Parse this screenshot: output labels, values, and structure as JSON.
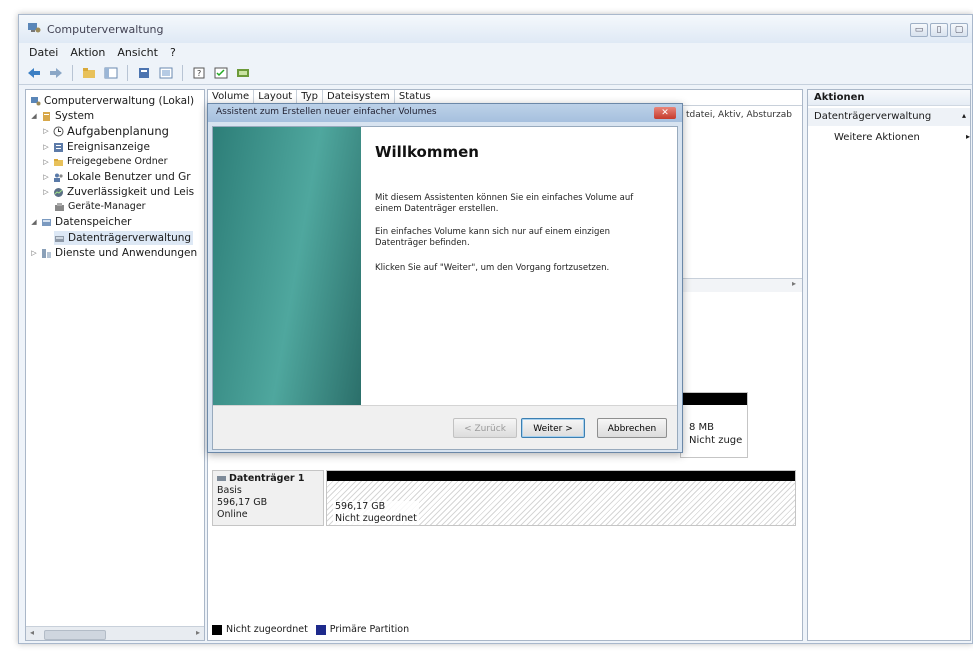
{
  "window": {
    "title": "Computerverwaltung",
    "controls": [
      "▭",
      "▯",
      "▢"
    ]
  },
  "menu": [
    "Datei",
    "Aktion",
    "Ansicht",
    "?"
  ],
  "tree": {
    "root": "Computerverwaltung (Lokal)",
    "system": "System",
    "aufgabenplanung": "Aufgabenplanung",
    "ereignisanzeige": "Ereignisanzeige",
    "freigegebene": "Freigegebene Ordner",
    "lokale": "Lokale Benutzer und Gr",
    "zuverlaessigkeit": "Zuverlässigkeit und Leis",
    "geraete": "Geräte-Manager",
    "datenspeicher": "Datenspeicher",
    "datentraeger": "Datenträgerverwaltung",
    "dienste": "Dienste und Anwendungen"
  },
  "columns": [
    "Volume",
    "Layout",
    "Typ",
    "Dateisystem",
    "Status"
  ],
  "volume_status": "tdatei, Aktiv, Absturzab",
  "disk0_partition": {
    "size": "8 MB",
    "status": "Nicht zuge"
  },
  "disk1": {
    "name": "Datenträger 1",
    "type": "Basis",
    "size": "596,17 GB",
    "state": "Online",
    "partition_size": "596,17 GB",
    "partition_status": "Nicht zugeordnet"
  },
  "legend": {
    "unallocated": "Nicht zugeordnet",
    "primary": "Primäre Partition"
  },
  "actions": {
    "header": "Aktionen",
    "section": "Datenträgerverwaltung",
    "more": "Weitere Aktionen"
  },
  "dialog": {
    "title": "Assistent zum Erstellen neuer einfacher Volumes",
    "heading": "Willkommen",
    "p1": "Mit diesem Assistenten können Sie ein einfaches Volume auf einem Datenträger erstellen.",
    "p2": "Ein einfaches Volume kann sich nur auf einem einzigen Datenträger befinden.",
    "p3": "Klicken Sie auf \"Weiter\", um den Vorgang fortzusetzen.",
    "back": "< Zurück",
    "next": "Weiter >",
    "cancel": "Abbrechen",
    "close": "✕"
  },
  "colors": {
    "legend_unallocated": "#000000",
    "legend_primary": "#1e2a8c",
    "wizard_banner": "#3f948c"
  }
}
